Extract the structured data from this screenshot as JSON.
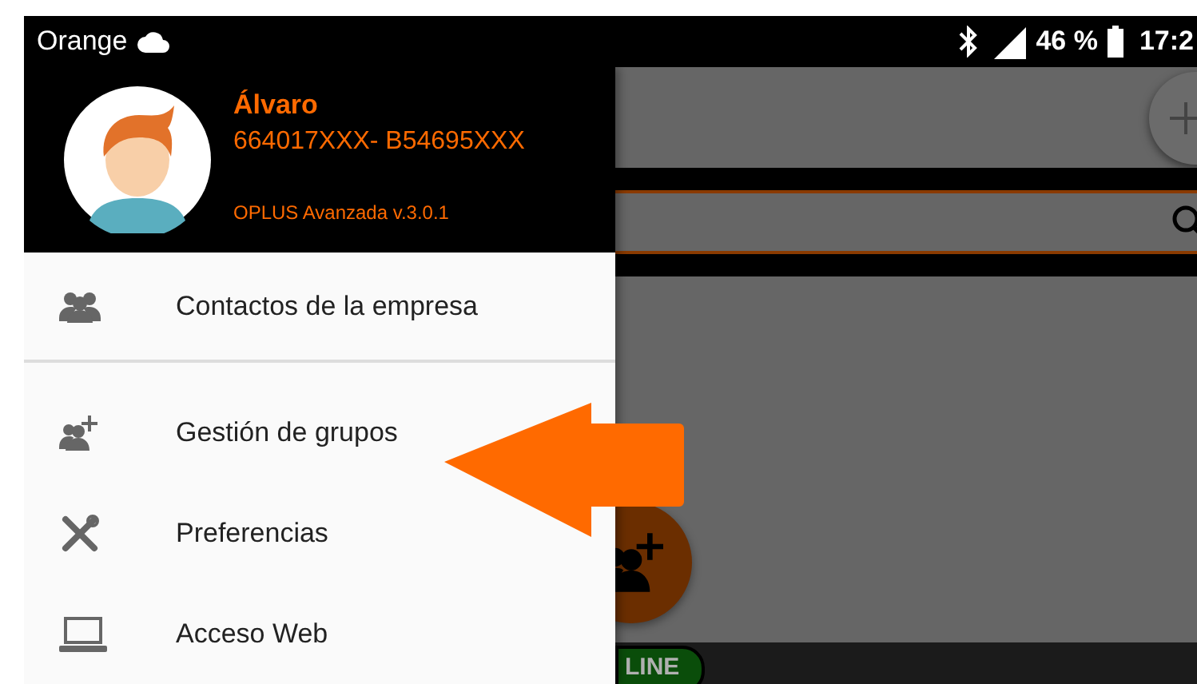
{
  "status_bar": {
    "carrier": "Orange",
    "battery": "46 %",
    "time": "17:2"
  },
  "drawer": {
    "header": {
      "name": "Álvaro",
      "account": "664017XXX- B54695XXX",
      "version": "OPLUS Avanzada v.3.0.1"
    },
    "sections": [
      [
        {
          "kind": "contacts",
          "label": "Contactos de la empresa"
        }
      ],
      [
        {
          "kind": "groups",
          "label": "Gestión de grupos"
        },
        {
          "kind": "tools",
          "label": "Preferencias"
        },
        {
          "kind": "computer",
          "label": "Acceso Web"
        }
      ]
    ]
  },
  "status_badge": "LINE"
}
